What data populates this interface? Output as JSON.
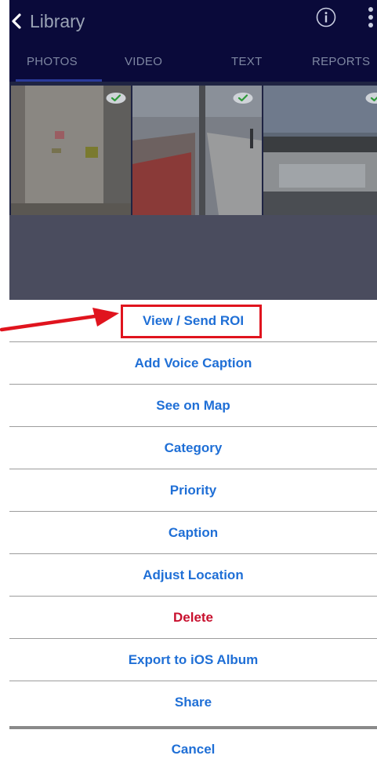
{
  "header": {
    "back_label": "Library",
    "back_icon": "chevron-left-icon",
    "info_icon": "info-icon",
    "more_icon": "more-vertical-icon"
  },
  "tabs": [
    {
      "label": "PHOTOS",
      "active": true
    },
    {
      "label": "VIDEO",
      "active": false
    },
    {
      "label": "TEXT",
      "active": false
    },
    {
      "label": "REPORTS",
      "active": false
    }
  ],
  "photos": [
    {
      "description_icon": "photo-thumbnail",
      "synced": true
    },
    {
      "description_icon": "photo-thumbnail",
      "synced": true
    },
    {
      "description_icon": "photo-thumbnail",
      "synced": true
    }
  ],
  "action_sheet": {
    "items": [
      {
        "label": "View / Send ROI",
        "style": "default",
        "highlighted": true
      },
      {
        "label": "Add Voice Caption",
        "style": "default"
      },
      {
        "label": "See on Map",
        "style": "default"
      },
      {
        "label": "Category",
        "style": "default"
      },
      {
        "label": "Priority",
        "style": "default"
      },
      {
        "label": "Caption",
        "style": "default"
      },
      {
        "label": "Adjust Location",
        "style": "default"
      },
      {
        "label": "Delete",
        "style": "destructive"
      },
      {
        "label": "Export to iOS Album",
        "style": "default"
      },
      {
        "label": "Share",
        "style": "default"
      }
    ],
    "cancel_label": "Cancel"
  },
  "colors": {
    "header_bg": "#0a0a3a",
    "action_blue": "#1f6fd6",
    "destructive_red": "#c8102e",
    "annotation_red": "#e0141e",
    "check_green": "#2e9a3a"
  }
}
